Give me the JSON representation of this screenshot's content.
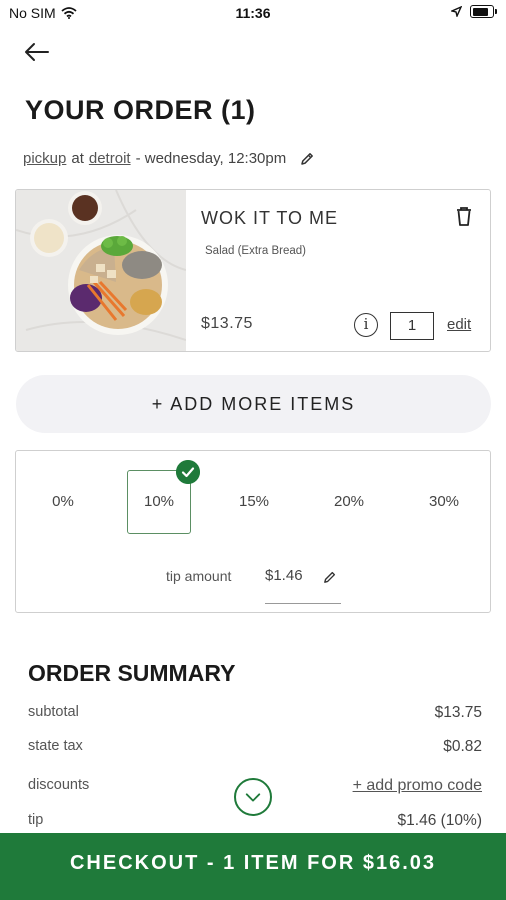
{
  "status_bar": {
    "carrier": "No SIM",
    "time": "11:36"
  },
  "order": {
    "title": "YOUR ORDER (1)",
    "mode": "pickup",
    "at": "at",
    "location": "detroit",
    "schedule": "- wednesday, 12:30pm"
  },
  "item": {
    "name": "WOK IT TO ME",
    "modifier": "Salad (Extra Bread)",
    "price": "$13.75",
    "quantity": "1",
    "edit_label": "edit"
  },
  "add_more_label": "+ ADD MORE ITEMS",
  "tip": {
    "options": [
      "0%",
      "10%",
      "15%",
      "20%",
      "30%"
    ],
    "selected": "10%",
    "amount_label": "tip amount",
    "amount_value": "$1.46"
  },
  "summary": {
    "title": "ORDER SUMMARY",
    "rows": [
      {
        "label": "subtotal",
        "value": "$13.75"
      },
      {
        "label": "state tax",
        "value": "$0.82"
      },
      {
        "label": "discounts",
        "value": "+ add promo code"
      },
      {
        "label": "tip",
        "value": "$1.46 (10%)"
      }
    ]
  },
  "checkout_label": "CHECKOUT - 1 ITEM FOR $16.03",
  "colors": {
    "accent_green": "#1f7a3a",
    "pill_bg": "#f2f2f5"
  }
}
